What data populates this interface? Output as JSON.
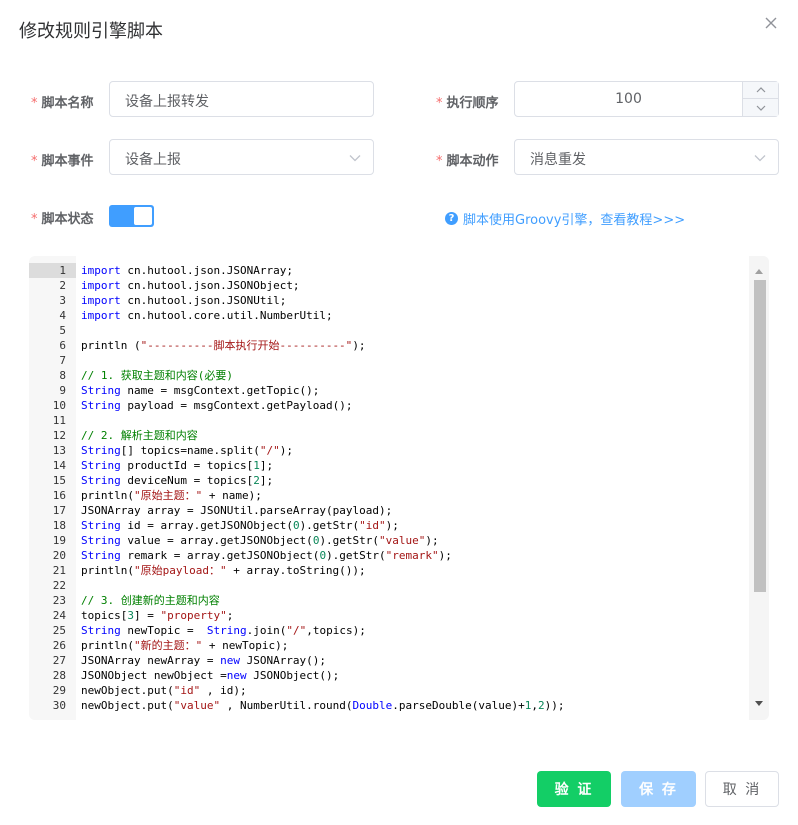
{
  "dialog": {
    "title": "修改规则引擎脚本",
    "close_icon": "close-icon"
  },
  "form": {
    "required_mark": "*",
    "script_name": {
      "label": "脚本名称",
      "value": "设备上报转发"
    },
    "exec_order": {
      "label": "执行顺序",
      "value": "100"
    },
    "script_event": {
      "label": "脚本事件",
      "value": "设备上报"
    },
    "script_action": {
      "label": "脚本动作",
      "value": "消息重发"
    },
    "script_status": {
      "label": "脚本状态",
      "enabled": true
    },
    "help_text": "脚本使用Groovy引擎，查看教程>>>",
    "help_icon": "?"
  },
  "editor": {
    "active_line": 1,
    "lines": [
      {
        "n": "1",
        "segs": [
          {
            "t": "import",
            "c": "kw"
          },
          {
            "t": " cn.hutool.json.JSONArray;",
            "c": "p"
          }
        ]
      },
      {
        "n": "2",
        "segs": [
          {
            "t": "import",
            "c": "kw"
          },
          {
            "t": " cn.hutool.json.JSONObject;",
            "c": "p"
          }
        ]
      },
      {
        "n": "3",
        "segs": [
          {
            "t": "import",
            "c": "kw"
          },
          {
            "t": " cn.hutool.json.JSONUtil;",
            "c": "p"
          }
        ]
      },
      {
        "n": "4",
        "segs": [
          {
            "t": "import",
            "c": "kw"
          },
          {
            "t": " cn.hutool.core.util.NumberUtil;",
            "c": "p"
          }
        ]
      },
      {
        "n": "5",
        "segs": []
      },
      {
        "n": "6",
        "segs": [
          {
            "t": "println (",
            "c": "p"
          },
          {
            "t": "\"----------脚本执行开始----------\"",
            "c": "str"
          },
          {
            "t": ");",
            "c": "p"
          }
        ]
      },
      {
        "n": "7",
        "segs": []
      },
      {
        "n": "8",
        "segs": [
          {
            "t": "// 1. 获取主题和内容(必要)",
            "c": "cm"
          }
        ]
      },
      {
        "n": "9",
        "segs": [
          {
            "t": "String",
            "c": "kw"
          },
          {
            "t": " name = msgContext.getTopic();",
            "c": "p"
          }
        ]
      },
      {
        "n": "10",
        "segs": [
          {
            "t": "String",
            "c": "kw"
          },
          {
            "t": " payload = msgContext.getPayload();",
            "c": "p"
          }
        ]
      },
      {
        "n": "11",
        "segs": []
      },
      {
        "n": "12",
        "segs": [
          {
            "t": "// 2. 解析主题和内容",
            "c": "cm"
          }
        ]
      },
      {
        "n": "13",
        "segs": [
          {
            "t": "String",
            "c": "kw"
          },
          {
            "t": "[] topics=name.split(",
            "c": "p"
          },
          {
            "t": "\"/\"",
            "c": "str"
          },
          {
            "t": ");",
            "c": "p"
          }
        ]
      },
      {
        "n": "14",
        "segs": [
          {
            "t": "String",
            "c": "kw"
          },
          {
            "t": " productId = topics[",
            "c": "p"
          },
          {
            "t": "1",
            "c": "num"
          },
          {
            "t": "];",
            "c": "p"
          }
        ]
      },
      {
        "n": "15",
        "segs": [
          {
            "t": "String",
            "c": "kw"
          },
          {
            "t": " deviceNum = topics[",
            "c": "p"
          },
          {
            "t": "2",
            "c": "num"
          },
          {
            "t": "];",
            "c": "p"
          }
        ]
      },
      {
        "n": "16",
        "segs": [
          {
            "t": "println(",
            "c": "p"
          },
          {
            "t": "\"原始主题：\"",
            "c": "str"
          },
          {
            "t": " + name);",
            "c": "p"
          }
        ]
      },
      {
        "n": "17",
        "segs": [
          {
            "t": "JSONArray array = JSONUtil.parseArray(payload);",
            "c": "p"
          }
        ]
      },
      {
        "n": "18",
        "segs": [
          {
            "t": "String",
            "c": "kw"
          },
          {
            "t": " id = array.getJSONObject(",
            "c": "p"
          },
          {
            "t": "0",
            "c": "num"
          },
          {
            "t": ").getStr(",
            "c": "p"
          },
          {
            "t": "\"id\"",
            "c": "str"
          },
          {
            "t": ");",
            "c": "p"
          }
        ]
      },
      {
        "n": "19",
        "segs": [
          {
            "t": "String",
            "c": "kw"
          },
          {
            "t": " value = array.getJSONObject(",
            "c": "p"
          },
          {
            "t": "0",
            "c": "num"
          },
          {
            "t": ").getStr(",
            "c": "p"
          },
          {
            "t": "\"value\"",
            "c": "str"
          },
          {
            "t": ");",
            "c": "p"
          }
        ]
      },
      {
        "n": "20",
        "segs": [
          {
            "t": "String",
            "c": "kw"
          },
          {
            "t": " remark = array.getJSONObject(",
            "c": "p"
          },
          {
            "t": "0",
            "c": "num"
          },
          {
            "t": ").getStr(",
            "c": "p"
          },
          {
            "t": "\"remark\"",
            "c": "str"
          },
          {
            "t": ");",
            "c": "p"
          }
        ]
      },
      {
        "n": "21",
        "segs": [
          {
            "t": "println(",
            "c": "p"
          },
          {
            "t": "\"原始payload：\"",
            "c": "str"
          },
          {
            "t": " + array.toString());",
            "c": "p"
          }
        ]
      },
      {
        "n": "22",
        "segs": []
      },
      {
        "n": "23",
        "segs": [
          {
            "t": "// 3. 创建新的主题和内容",
            "c": "cm"
          }
        ]
      },
      {
        "n": "24",
        "segs": [
          {
            "t": "topics[",
            "c": "p"
          },
          {
            "t": "3",
            "c": "num"
          },
          {
            "t": "] = ",
            "c": "p"
          },
          {
            "t": "\"property\"",
            "c": "str"
          },
          {
            "t": ";",
            "c": "p"
          }
        ]
      },
      {
        "n": "25",
        "segs": [
          {
            "t": "String",
            "c": "kw"
          },
          {
            "t": " newTopic =  ",
            "c": "p"
          },
          {
            "t": "String",
            "c": "kw"
          },
          {
            "t": ".join(",
            "c": "p"
          },
          {
            "t": "\"/\"",
            "c": "str"
          },
          {
            "t": ",topics);",
            "c": "p"
          }
        ]
      },
      {
        "n": "26",
        "segs": [
          {
            "t": "println(",
            "c": "p"
          },
          {
            "t": "\"新的主题：\"",
            "c": "str"
          },
          {
            "t": " + newTopic);",
            "c": "p"
          }
        ]
      },
      {
        "n": "27",
        "segs": [
          {
            "t": "JSONArray newArray = ",
            "c": "p"
          },
          {
            "t": "new",
            "c": "kw"
          },
          {
            "t": " JSONArray();",
            "c": "p"
          }
        ]
      },
      {
        "n": "28",
        "segs": [
          {
            "t": "JSONObject newObject =",
            "c": "p"
          },
          {
            "t": "new",
            "c": "kw"
          },
          {
            "t": " JSONObject();",
            "c": "p"
          }
        ]
      },
      {
        "n": "29",
        "segs": [
          {
            "t": "newObject.put(",
            "c": "p"
          },
          {
            "t": "\"id\"",
            "c": "str"
          },
          {
            "t": " , id);",
            "c": "p"
          }
        ]
      },
      {
        "n": "30",
        "segs": [
          {
            "t": "newObject.put(",
            "c": "p"
          },
          {
            "t": "\"value\"",
            "c": "str"
          },
          {
            "t": " , NumberUtil.round(",
            "c": "p"
          },
          {
            "t": "Double",
            "c": "kw"
          },
          {
            "t": ".parseDouble(value)+",
            "c": "p"
          },
          {
            "t": "1",
            "c": "num"
          },
          {
            "t": ",",
            "c": "p"
          },
          {
            "t": "2",
            "c": "num"
          },
          {
            "t": "));",
            "c": "p"
          }
        ]
      }
    ]
  },
  "colors": {
    "kw": "#0000ff",
    "str": "#a31515",
    "cm": "#008000",
    "num": "#098658",
    "p": "#000000",
    "accent": "#409eff",
    "success": "#13ce66"
  },
  "footer": {
    "verify_label": "验 证",
    "save_label": "保 存",
    "cancel_label": "取 消"
  }
}
